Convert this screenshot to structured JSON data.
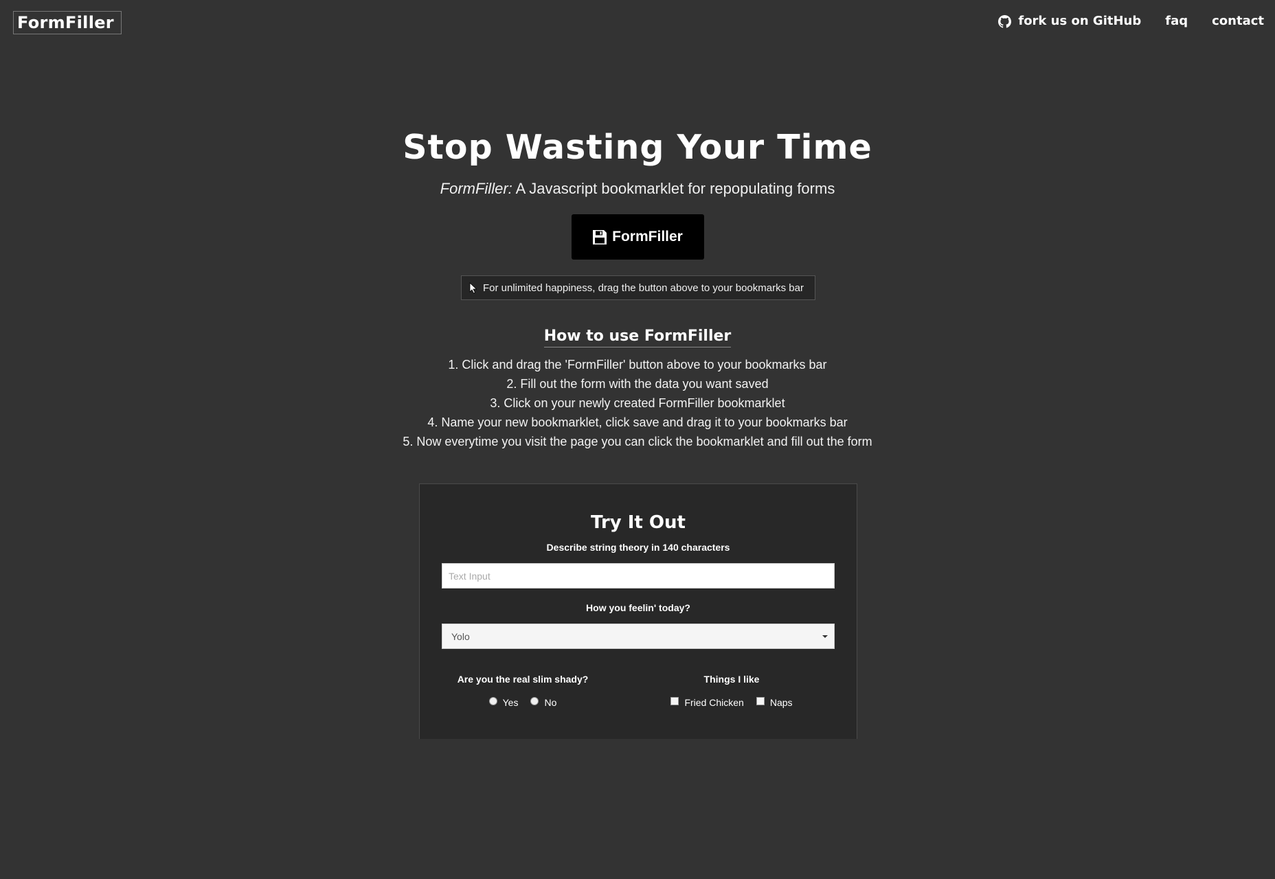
{
  "header": {
    "logo": "FormFiller",
    "nav": {
      "github": "fork us on GitHub",
      "faq": "faq",
      "contact": "contact"
    }
  },
  "hero": {
    "title": "Stop Wasting Your Time",
    "subtitle_name": "FormFiller:",
    "subtitle_rest": " A Javascript bookmarklet for repopulating forms",
    "button_label": "FormFiller",
    "hint": "For unlimited happiness, drag the button above to your bookmarks bar"
  },
  "howto": {
    "title": "How to use FormFiller",
    "steps": [
      "1. Click and drag the 'FormFiller' button above to your bookmarks bar",
      "2. Fill out the form with the data you want saved",
      "3. Click on your newly created FormFiller bookmarklet",
      "4. Name your new bookmarklet, click save and drag it to your bookmarks bar",
      "5. Now everytime you visit the page you can click the bookmarklet and fill out the form"
    ]
  },
  "tryit": {
    "title": "Try It Out",
    "text_label": "Describe string theory in 140 characters",
    "text_placeholder": "Text Input",
    "select_label": "How you feelin' today?",
    "select_value": "Yolo",
    "radio_label": "Are you the real slim shady?",
    "radio_options": [
      "Yes",
      "No"
    ],
    "checkbox_label": "Things I like",
    "checkbox_options": [
      "Fried Chicken",
      "Naps"
    ]
  },
  "icons": {
    "github": "github-icon",
    "floppy": "floppy-disk-icon",
    "cursor": "mouse-pointer-icon",
    "caret": "caret-down-icon"
  }
}
